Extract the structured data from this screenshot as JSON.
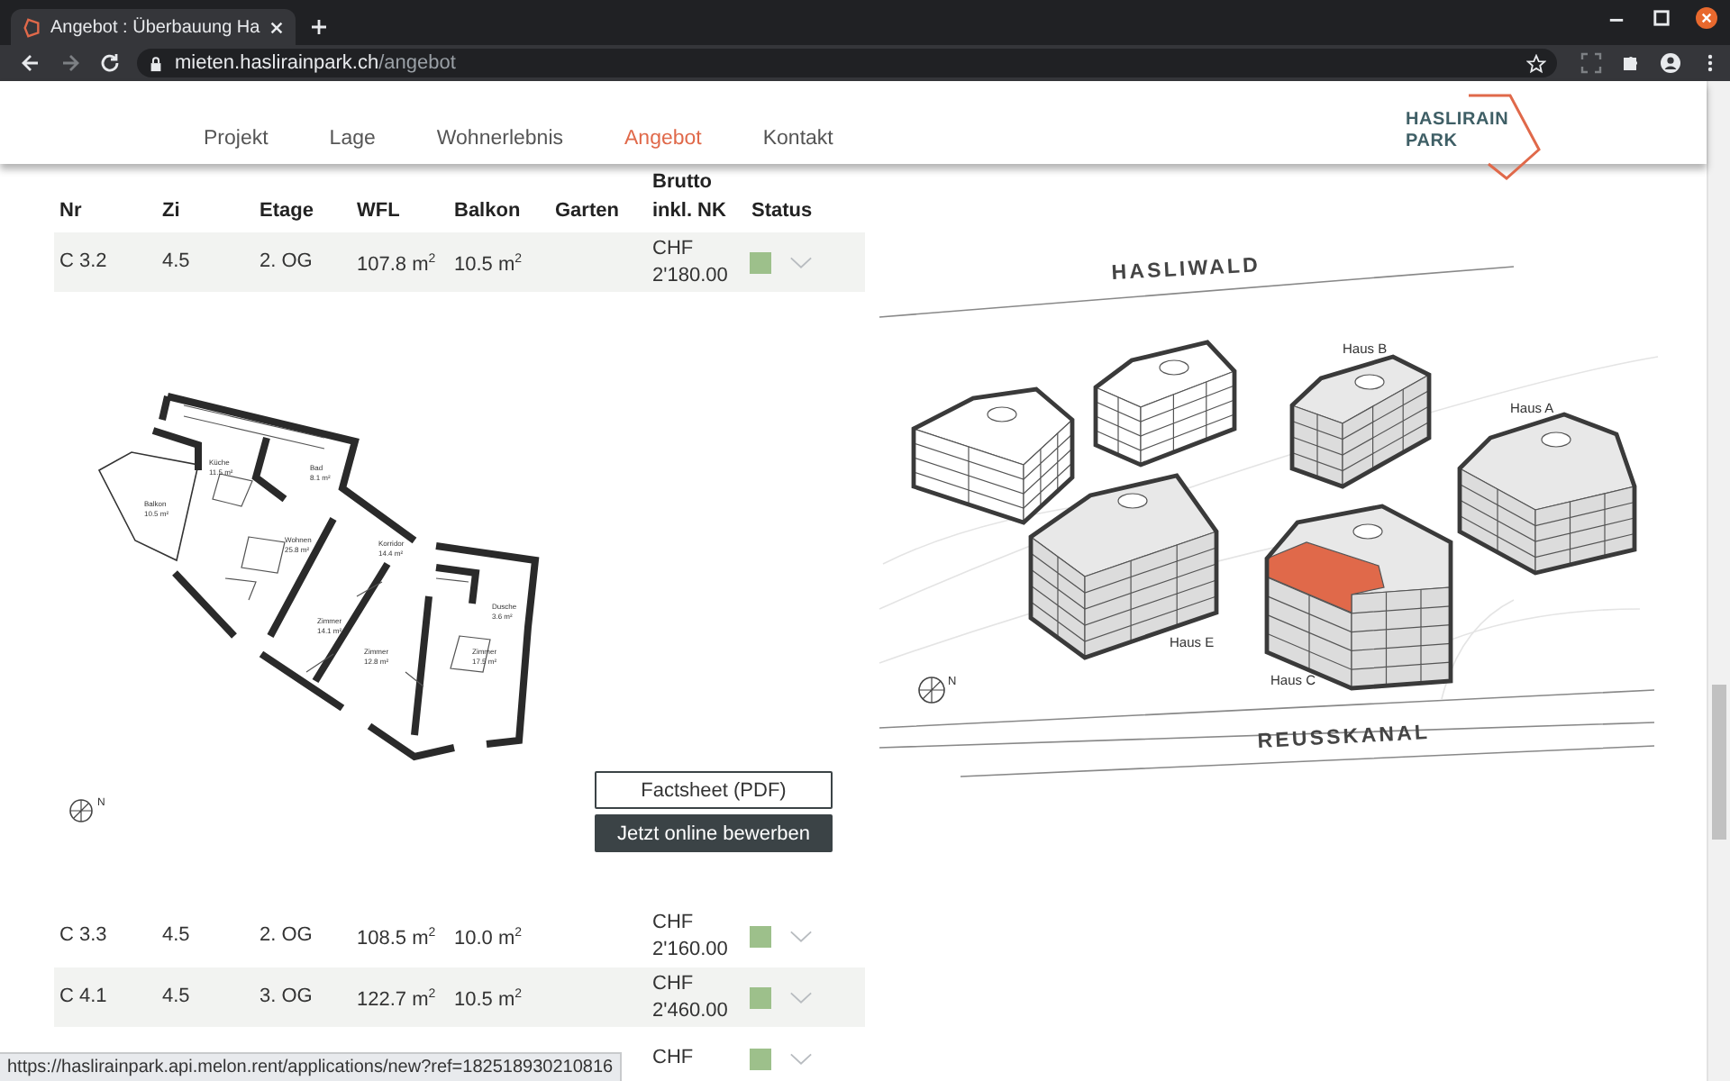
{
  "browser": {
    "tab_title": "Angebot : Überbauung Ha",
    "url_host": "mieten.haslirainpark.ch",
    "url_path": "/angebot",
    "status_url": "https://haslirainpark.api.melon.rent/applications/new?ref=182518930210816"
  },
  "logo": {
    "line1": "HASLIRAIN",
    "line2": "PARK"
  },
  "nav": [
    {
      "label": "Projekt",
      "selected": false
    },
    {
      "label": "Lage",
      "selected": false
    },
    {
      "label": "Wohnerlebnis",
      "selected": false
    },
    {
      "label": "Angebot",
      "selected": true
    },
    {
      "label": "Kontakt",
      "selected": false
    }
  ],
  "table": {
    "columns": [
      "Nr",
      "Zi",
      "Etage",
      "WFL",
      "Balkon",
      "Garten",
      "Brutto inkl. NK",
      "Status"
    ],
    "rows": [
      {
        "nr": "C 3.2",
        "zi": "4.5",
        "etage": "2. OG",
        "wfl": "107.8 m$^{2}$",
        "balkon": "10.5 m$^{2}$",
        "price": "CHF 2'180.00",
        "color": "#9dc08b",
        "detail": {
          "rooms": [
            {
              "name": "Küche",
              "area": "11.5 m²"
            },
            {
              "name": "Bad",
              "area": "8.1 m²"
            },
            {
              "name": "Balkon",
              "area": "10.5 m²"
            },
            {
              "name": "Wohnen",
              "area": "25.8 m²"
            },
            {
              "name": "Korridor",
              "area": "14.4 m²"
            },
            {
              "name": "Dusche",
              "area": "3.6 m²"
            },
            {
              "name": "Zimmer",
              "area": "14.1 m²"
            },
            {
              "name": "Zimmer",
              "area": "12.8 m²"
            },
            {
              "name": "Zimmer",
              "area": "17.5 m²"
            }
          ],
          "compass": "N",
          "buttons": [
            {
              "label": "Factsheet (PDF)",
              "kind": "outline"
            },
            {
              "label": "Jetzt online bewerben",
              "kind": "filled"
            }
          ]
        }
      },
      {
        "nr": "C 3.3",
        "zi": "4.5",
        "etage": "2. OG",
        "wfl": "108.5 m$^{2}$",
        "balkon": "10.0 m$^{2}$",
        "price": "CHF 2'160.00",
        "color": "#9dc08b"
      },
      {
        "nr": "C 4.1",
        "zi": "4.5",
        "etage": "3. OG",
        "wfl": "122.7 m$^{2}$",
        "balkon": "10.5 m$^{2}$",
        "price": "CHF 2'460.00",
        "color": "#9dc08b"
      },
      {
        "price": "CHF",
        "color": "#9dc08b"
      }
    ]
  },
  "site_map": {
    "streets": [
      "HASLIWALD",
      "REUSSKANAL"
    ],
    "houses": [
      "Haus B",
      "Haus A",
      "Haus E",
      "Haus C"
    ],
    "compass": "N"
  }
}
